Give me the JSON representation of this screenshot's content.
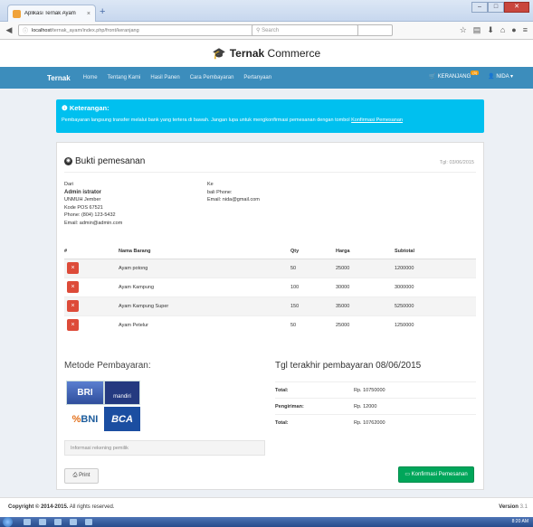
{
  "browser": {
    "tab_title": "Aplikasi Ternak Ayam",
    "tab_close": "×",
    "new_tab": "+",
    "url_host": "localhost",
    "url_path": "/ternak_ayam/index.php/front/keranjang",
    "search_placeholder": "Search",
    "win_min": "–",
    "win_max": "□",
    "win_close": "✕"
  },
  "brand": {
    "icon": "graduation-cap-icon",
    "name_bold": "Ternak",
    "name_rest": " Commerce"
  },
  "nav": {
    "logo": "Ternak",
    "items": [
      "Home",
      "Tentang Kami",
      "Hasil Panen",
      "Cara Pembayaran",
      "Pertanyaan"
    ],
    "cart_label": "KERANJANG",
    "cart_count": "(5)",
    "user_label": "NIDA ▾"
  },
  "alert": {
    "title": "Keterangan:",
    "text": "Pembayaran langsung transfer melalui bank yang tertera di bawah. Jangan lupa untuk mengkonfirmasi pemesanan dengan tombol ",
    "link": "Konfirmasi Pemesanan"
  },
  "invoice": {
    "title": "Bukti pemesanan",
    "date": "Tgl: 03/06/2015",
    "from_label": "Dari",
    "from_name": "Admin istrator",
    "from_lines": [
      "UNMUH Jember",
      "Kode POS 67521",
      "Phone: (804) 123-5432",
      "Email: admin@admin.com"
    ],
    "to_label": "Ke",
    "to_lines": [
      "",
      "bali Phone:",
      "Email: nida@gmail.com"
    ],
    "columns": [
      "#",
      "Nama Barang",
      "Qty",
      "Harga",
      "Subtotal"
    ],
    "delete_glyph": "×",
    "rows": [
      {
        "name": "Ayam potong",
        "qty": "50",
        "price": "25000",
        "subtotal": "1200000"
      },
      {
        "name": "Ayam Kampung",
        "qty": "100",
        "price": "30000",
        "subtotal": "3000000"
      },
      {
        "name": "Ayam Kampung Super",
        "qty": "150",
        "price": "35000",
        "subtotal": "5250000"
      },
      {
        "name": "Ayam Petelur",
        "qty": "50",
        "price": "25000",
        "subtotal": "1250000"
      }
    ],
    "payment_title": "Metode Pembayaran:",
    "banks": {
      "bri": "BRI",
      "mandiri": "mandiri",
      "bni_mark": "%",
      "bni": "BNI",
      "bca": "BCA"
    },
    "note_placeholder": "Informasi rekening pemilik",
    "due_title": "Tgl terakhir pembayaran 08/06/2015",
    "totals": [
      {
        "label": "Total:",
        "value": "Rp. 10750000"
      },
      {
        "label": "Pengiriman:",
        "value": "Rp. 12000"
      },
      {
        "label": "Total:",
        "value": "Rp. 10762000"
      }
    ],
    "print_label": "Print",
    "confirm_label": "Konfirmasi Pemesanan"
  },
  "footer": {
    "copyright": "Copyright © 2014-2015.",
    "rights": " All rights reserved.",
    "version_label": "Version",
    "version": " 3.1"
  },
  "taskbar": {
    "clock": "8:20 AM"
  }
}
